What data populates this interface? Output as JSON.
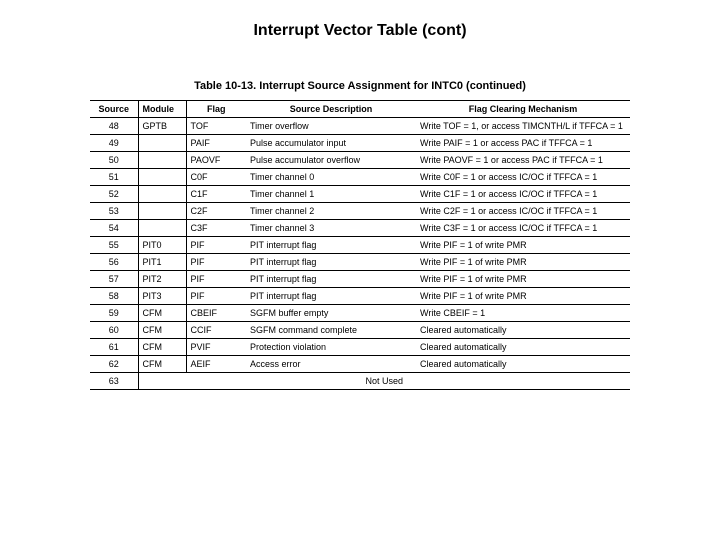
{
  "title": "Interrupt Vector Table (cont)",
  "table": {
    "caption": "Table 10-13. Interrupt Source Assignment for INTC0 (continued)",
    "headers": {
      "source": "Source",
      "module": "Module",
      "flag": "Flag",
      "desc": "Source Description",
      "mech": "Flag Clearing Mechanism"
    },
    "rows": [
      {
        "source": "48",
        "module": "GPTB",
        "flag": "TOF",
        "desc": "Timer overflow",
        "mech": "Write TOF = 1, or access TIMCNTH/L if TFFCA = 1"
      },
      {
        "source": "49",
        "module": "",
        "flag": "PAIF",
        "desc": "Pulse accumulator input",
        "mech": "Write PAIF = 1 or access PAC if TFFCA = 1"
      },
      {
        "source": "50",
        "module": "",
        "flag": "PAOVF",
        "desc": "Pulse accumulator overflow",
        "mech": "Write PAOVF = 1 or access PAC if TFFCA = 1"
      },
      {
        "source": "51",
        "module": "",
        "flag": "C0F",
        "desc": "Timer channel 0",
        "mech": "Write C0F = 1 or access IC/OC if TFFCA = 1"
      },
      {
        "source": "52",
        "module": "",
        "flag": "C1F",
        "desc": "Timer channel 1",
        "mech": "Write C1F = 1 or access IC/OC if TFFCA = 1"
      },
      {
        "source": "53",
        "module": "",
        "flag": "C2F",
        "desc": "Timer channel 2",
        "mech": "Write C2F = 1 or access IC/OC if TFFCA = 1"
      },
      {
        "source": "54",
        "module": "",
        "flag": "C3F",
        "desc": "Timer channel 3",
        "mech": "Write C3F = 1 or access IC/OC if TFFCA = 1"
      },
      {
        "source": "55",
        "module": "PIT0",
        "flag": "PIF",
        "desc": "PIT interrupt flag",
        "mech": "Write PIF = 1 of write PMR"
      },
      {
        "source": "56",
        "module": "PIT1",
        "flag": "PIF",
        "desc": "PIT interrupt flag",
        "mech": "Write PIF = 1 of write PMR"
      },
      {
        "source": "57",
        "module": "PIT2",
        "flag": "PIF",
        "desc": "PIT interrupt flag",
        "mech": "Write PIF = 1 of write PMR"
      },
      {
        "source": "58",
        "module": "PIT3",
        "flag": "PIF",
        "desc": "PIT interrupt flag",
        "mech": "Write PIF = 1 of write PMR"
      },
      {
        "source": "59",
        "module": "CFM",
        "flag": "CBEIF",
        "desc": "SGFM buffer empty",
        "mech": "Write CBEIF = 1"
      },
      {
        "source": "60",
        "module": "CFM",
        "flag": "CCIF",
        "desc": "SGFM command complete",
        "mech": "Cleared automatically"
      },
      {
        "source": "61",
        "module": "CFM",
        "flag": "PVIF",
        "desc": "Protection violation",
        "mech": "Cleared automatically"
      },
      {
        "source": "62",
        "module": "CFM",
        "flag": "AEIF",
        "desc": "Access error",
        "mech": "Cleared automatically"
      }
    ],
    "notused": {
      "source": "63",
      "label": "Not Used"
    }
  }
}
